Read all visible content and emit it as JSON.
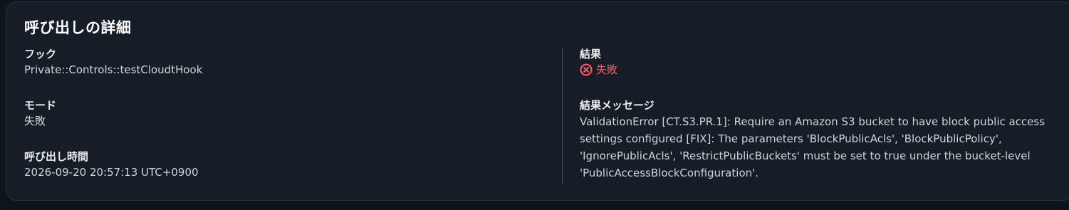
{
  "panel": {
    "title": "呼び出しの詳細"
  },
  "left": {
    "hook_label": "フック",
    "hook_value": "Private::Controls::testCloudtHook",
    "mode_label": "モード",
    "mode_value": "失敗",
    "time_label": "呼び出し時間",
    "time_value": "2026-09-20 20:57:13 UTC+0900"
  },
  "right": {
    "result_label": "結果",
    "result_value": "失敗",
    "result_icon": "error-circle-x-icon",
    "message_label": "結果メッセージ",
    "message_value": "ValidationError [CT.S3.PR.1]: Require an Amazon S3 bucket to have block public access settings configured [FIX]: The parameters 'BlockPublicAcls', 'BlockPublicPolicy', 'IgnorePublicAcls', 'RestrictPublicBuckets' must be set to true under the bucket-level 'PublicAccessBlockConfiguration'."
  },
  "colors": {
    "background": "#0f141a",
    "panel": "#161d26",
    "border": "#2b3441",
    "error": "#ff5d64",
    "heading": "#ffffff"
  }
}
